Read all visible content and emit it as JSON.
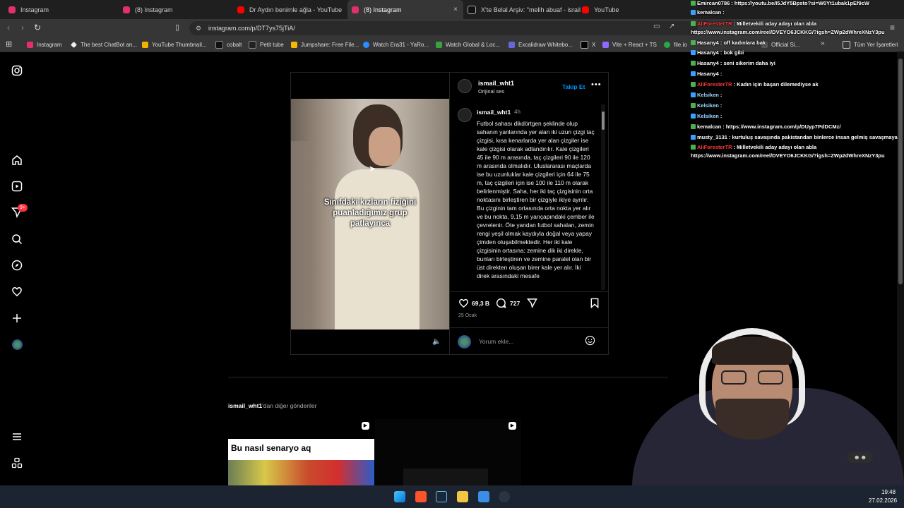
{
  "browser": {
    "tabs": [
      {
        "title": "Instagram",
        "color": "#e1306c",
        "active": false
      },
      {
        "title": "(8) Instagram",
        "color": "#e1306c",
        "active": false
      },
      {
        "title": "Dr Aydın benimle ağla - YouTube",
        "color": "#ff0000",
        "active": false
      },
      {
        "title": "(8) Instagram",
        "color": "#e1306c",
        "active": true
      },
      {
        "title": "X'te Belal Arşiv: \"melih abuaf - israil",
        "color": "#ffffff",
        "active": false
      },
      {
        "title": "YouTube",
        "color": "#ff0000",
        "active": false
      }
    ],
    "tab_close": "×",
    "url": "instagram.com/p/DT7ys75jTiA/",
    "bookmarks": [
      "Instagram",
      "The best ChatBot an...",
      "YouTube Thumbnail...",
      "cobalt",
      "Petit tube",
      "Jumpshare: Free File...",
      "Watch Era31 - YaRo...",
      "Watch Global & Loc...",
      "Excalidraw Whitebo...",
      "X",
      "Vite + React + TS",
      "file.io",
      "Official Si..."
    ],
    "all_bookmarks": "Tüm Yer İşaretleri"
  },
  "sidebar": {
    "notification_badge": "9+"
  },
  "post": {
    "username": "ismail_wht1",
    "audio": "Orijinal ses",
    "follow": "Takip Et",
    "caption_user": "ismail_wht1",
    "caption_time": "4h",
    "caption": "Futbol sahası dikdörtgen şeklinde olup sahanın yanlarında yer alan iki uzun çizgi taç çizgisi, kısa kenarlarda yer alan çizgiler ise kale çizgisi olarak adlandırılır. Kale çizgileri 45 ile 90 m arasında, taç çizgileri 90 ile 120 m arasında olmalıdır. Uluslararası maçlarda ise bu uzunluklar kale çizgileri için 64 ile 75 m, taç çizgileri için ise 100 ile 110 m olarak belirlenmiştir. Saha, her iki taç çizgisinin orta noktasını birleştiren bir çizgiyle ikiye ayrılır. Bu çizginin tam ortasında orta nokta yer alır ve bu nokta, 9,15 m yarıçapındaki çember ile çevrelenir. Öte yandan futbol sahaları, zemin rengi yeşil olmak kaydıyla doğal veya yapay çimden oluşabilmektedir. Her iki kale çizgisinin ortasına; zemine dik iki direkle, bunları birleştiren ve zemine paralel olan bir üst direkten oluşan birer kale yer alır. İki direk arasındaki mesafe",
    "video_overlay": "Sınıfdaki kızların fiziğini puanladığımız grup patlayınca",
    "likes": "69,3 B",
    "comments": "727",
    "date": "25 Ocak",
    "comment_placeholder": "Yorum ekle..."
  },
  "more_posts": {
    "heading_user": "ismail_wht1",
    "heading_rest": "'dan diğer gönderiler",
    "first_caption": "Bu nasıl senaryo aq"
  },
  "chat": [
    {
      "user": "Emircan0786",
      "msg": ": https://youtu.be/I5JdY5Bpsto?si=W0Yt1ubak1pEf9cW",
      "color": "#ffffff"
    },
    {
      "user": "kemalcan",
      "msg": ":",
      "color": "#ffffff"
    },
    {
      "user": "AliForesterTR",
      "msg": ": Milletvekili aday adayı olan abla",
      "color": "#ff3b3b"
    },
    {
      "user": "",
      "msg": "https://www.instagram.com/reel/DVEYO6JCKKG/?igsh=ZWp2dWhreXNzY3pu",
      "color": "#ffffff"
    },
    {
      "user": "Hasany4",
      "msg": ": off kadınlara bak",
      "color": "#ffffff"
    },
    {
      "user": "Hasany4",
      "msg": ": bok gibi",
      "color": "#ffffff"
    },
    {
      "user": "Hasany4",
      "msg": ": seni sikerim daha iyi",
      "color": "#ffffff"
    },
    {
      "user": "Hasany4",
      "msg": ":",
      "color": "#ffffff"
    },
    {
      "user": "AliForesterTR",
      "msg": ": Kadın için başarı dilemediyse ak",
      "color": "#ff3b3b"
    },
    {
      "user": "Kelsiken",
      "msg": ":",
      "color": "#9ad8ff"
    },
    {
      "user": "Kelsiken",
      "msg": ":",
      "color": "#9ad8ff"
    },
    {
      "user": "Kelsiken",
      "msg": ":",
      "color": "#9ad8ff"
    },
    {
      "user": "kemalcan",
      "msg": ": https://www.instagram.com/p/DUyp7PdDCMz/",
      "color": "#ffffff"
    },
    {
      "user": "musty_3131",
      "msg": ": kurtuluş savaşında pakistandan binlerce insan gelmiş savaşmaya",
      "color": "#ffffff"
    },
    {
      "user": "AliForesterTR",
      "msg": ": Milletvekili aday adayı olan abla",
      "color": "#ff3b3b"
    },
    {
      "user": "",
      "msg": "https://www.instagram.com/reel/DVEYO6JCKKG/?igsh=ZWp2dWhreXNzY3pu",
      "color": "#ffffff"
    }
  ],
  "taskbar": {
    "time": "19:48",
    "date": "27.02.2026"
  },
  "colors": {
    "accent": "#0095f6",
    "page_bg": "#000000",
    "taskbar": "#1c2431"
  }
}
